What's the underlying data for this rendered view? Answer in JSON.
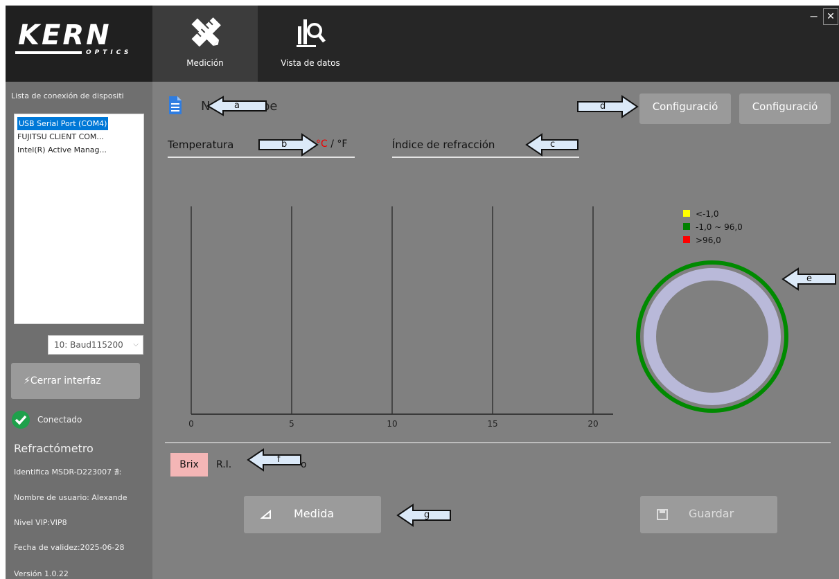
{
  "window": {
    "minimize_label": "−",
    "close_label": "✕"
  },
  "logo": {
    "brand": "KERN",
    "sub": "OPTICS"
  },
  "tabs": [
    {
      "label": "Medición",
      "icon": "pencil-ruler-icon",
      "active": true
    },
    {
      "label": "Vista de datos",
      "icon": "chart-search-icon",
      "active": false
    }
  ],
  "sidebar": {
    "device_list_title": "Lista de conexión de dispositi",
    "devices": [
      "USB Serial Port (COM4)",
      "FUJITSU CLIENT COM...",
      "Intel(R) Active Manag..."
    ],
    "baud_value": "10: Baud115200",
    "close_interface_label": "Cerrar interfaz",
    "status": "Conectado",
    "device_type": "Refractómetro",
    "identifier": "Identifica MSDR-D223007 ∄:",
    "username": "Nombre de usuario: Alexande",
    "vip_level": "Nivel VIP:VIP8",
    "expiry": "Fecha de validez:2025-06-28",
    "version": "Versión 1.0.22"
  },
  "main": {
    "name_prefix": "N",
    "name_suffix": "be",
    "config_btn_1": "Configuració",
    "config_btn_2": "Configuració",
    "temperature_label": "Temperatura",
    "unit_c": "°C",
    "unit_sep": "/",
    "unit_f": "°F",
    "refraction_label": "Índice de refracción",
    "legend": [
      {
        "color": "#ffff00",
        "label": "<-1,0"
      },
      {
        "color": "#008000",
        "label": "-1,0 ~ 96,0"
      },
      {
        "color": "#ff0000",
        "label": ">96,0"
      }
    ],
    "mode_brix": "Brix",
    "mode_ri": "R.I.",
    "mode_tail": "o",
    "measure_label": "Medida",
    "save_label": "Guardar"
  },
  "callouts": {
    "a": "a",
    "b": "b",
    "c": "c",
    "d": "d",
    "e": "e",
    "f": "f",
    "g": "g"
  },
  "chart_data": {
    "type": "line",
    "x_ticks": [
      "0",
      "5",
      "10",
      "15",
      "20"
    ],
    "xlim": [
      0,
      20
    ],
    "series": []
  },
  "colors": {
    "accent_blue": "#0078d7",
    "ring_outer": "#008000",
    "ring_inner": "#b9b9d9",
    "brix_bg": "#f4b6b6"
  }
}
